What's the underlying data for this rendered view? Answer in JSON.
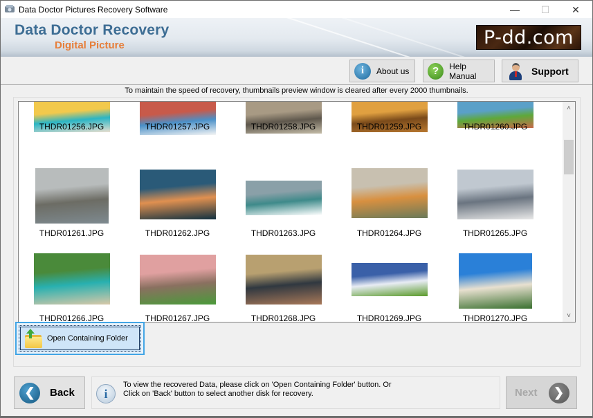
{
  "window": {
    "title": "Data Doctor Pictures Recovery Software",
    "controls": {
      "minimize": "—",
      "maximize": "☐",
      "close": "✕"
    }
  },
  "banner": {
    "title": "Data Doctor Recovery",
    "subtitle": "Digital Picture",
    "logo": "P-dd.com"
  },
  "toolbar": {
    "about_label": "About us",
    "about_icon": "i",
    "help_label": "Help Manual",
    "help_icon": "?",
    "support_label": "Support"
  },
  "notice": "To maintain the speed of recovery, thumbnails preview window is cleared after every 2000 thumbnails.",
  "gallery": {
    "thumbnails": [
      {
        "name": "THDR01256.JPG",
        "colors": [
          "#f2c94c",
          "#2bb5c4",
          "#e9dfd0"
        ]
      },
      {
        "name": "THDR01257.JPG",
        "colors": [
          "#c85a4a",
          "#4a90c8",
          "#f4f4f4"
        ]
      },
      {
        "name": "THDR01258.JPG",
        "colors": [
          "#a89a84",
          "#5e574c",
          "#c4bca8"
        ]
      },
      {
        "name": "THDR01259.JPG",
        "colors": [
          "#e0a040",
          "#7a4a1a",
          "#b87830"
        ]
      },
      {
        "name": "THDR01260.JPG",
        "colors": [
          "#5aa0c8",
          "#5ea83a",
          "#c86a4a"
        ]
      },
      {
        "name": "THDR01261.JPG",
        "colors": [
          "#b8bcbc",
          "#6c6c64",
          "#7e8a90"
        ]
      },
      {
        "name": "THDR01262.JPG",
        "colors": [
          "#2a5a78",
          "#e09050",
          "#103040"
        ]
      },
      {
        "name": "THDR01263.JPG",
        "colors": [
          "#8aa0a8",
          "#3e8a8a",
          "#ffffff"
        ]
      },
      {
        "name": "THDR01264.JPG",
        "colors": [
          "#c8c0b0",
          "#d89040",
          "#6a7a5a"
        ]
      },
      {
        "name": "THDR01265.JPG",
        "colors": [
          "#c0c8d0",
          "#6a7480",
          "#e8e8e8"
        ]
      },
      {
        "name": "THDR01266.JPG",
        "colors": [
          "#4a8a3a",
          "#28b0b0",
          "#d8c8a8"
        ]
      },
      {
        "name": "THDR01267.JPG",
        "colors": [
          "#e0a0a0",
          "#8a7060",
          "#4a9a3a"
        ]
      },
      {
        "name": "THDR01268.JPG",
        "colors": [
          "#b8a070",
          "#303840",
          "#a87858"
        ]
      },
      {
        "name": "THDR01269.JPG",
        "colors": [
          "#3a60a8",
          "#e8ecf4",
          "#5a9a2a"
        ]
      },
      {
        "name": "THDR01270.JPG",
        "colors": [
          "#2a80d8",
          "#e8e0d0",
          "#3a7030"
        ]
      }
    ],
    "scroll": {
      "up_icon": "˄",
      "down_icon": "˅"
    }
  },
  "open_folder": {
    "label": "Open Containing Folder"
  },
  "footer": {
    "back_label": "Back",
    "back_icon": "❮",
    "info_icon": "i",
    "info_line1": "To view the recovered Data, please click on 'Open Containing Folder' button. Or",
    "info_line2": "Click on 'Back' button to select another disk for recovery.",
    "next_label": "Next",
    "next_icon": "❯"
  }
}
